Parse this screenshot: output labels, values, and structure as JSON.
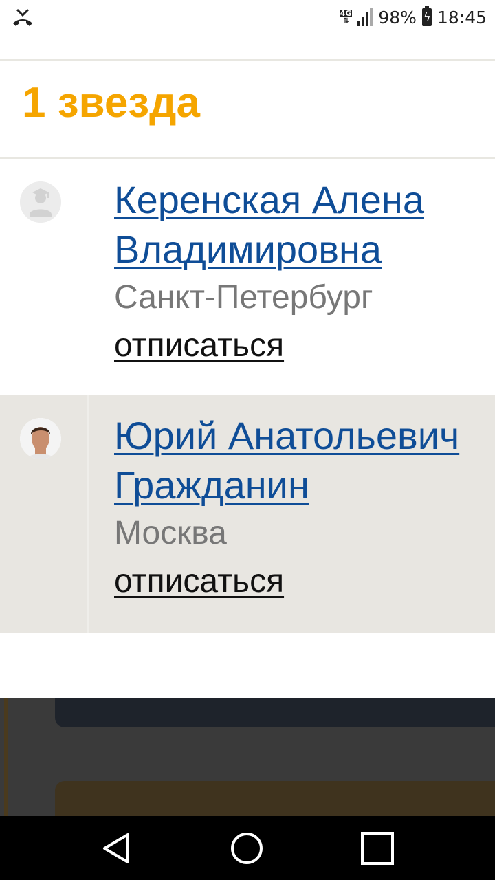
{
  "status_bar": {
    "network": "4G",
    "battery_percent": "98%",
    "time": "18:45"
  },
  "section": {
    "title": "1 звезда"
  },
  "people": [
    {
      "name_line1": "Керенская Алена",
      "name_line2": "Владимировна",
      "city": "Санкт-Петербург",
      "action": "отписаться",
      "avatar": "default-user-avatar"
    },
    {
      "name_line1": "Юрий Анатольевич",
      "name_line2": "Гражданин",
      "city": "Москва",
      "action": "отписаться",
      "avatar": "user-photo-avatar"
    }
  ],
  "colors": {
    "title": "#f5a500",
    "link": "#0f4d97",
    "city": "#777777",
    "alt_row": "#e8e6e1"
  },
  "nav": {
    "back": "back-icon",
    "home": "home-icon",
    "recents": "recents-icon"
  }
}
